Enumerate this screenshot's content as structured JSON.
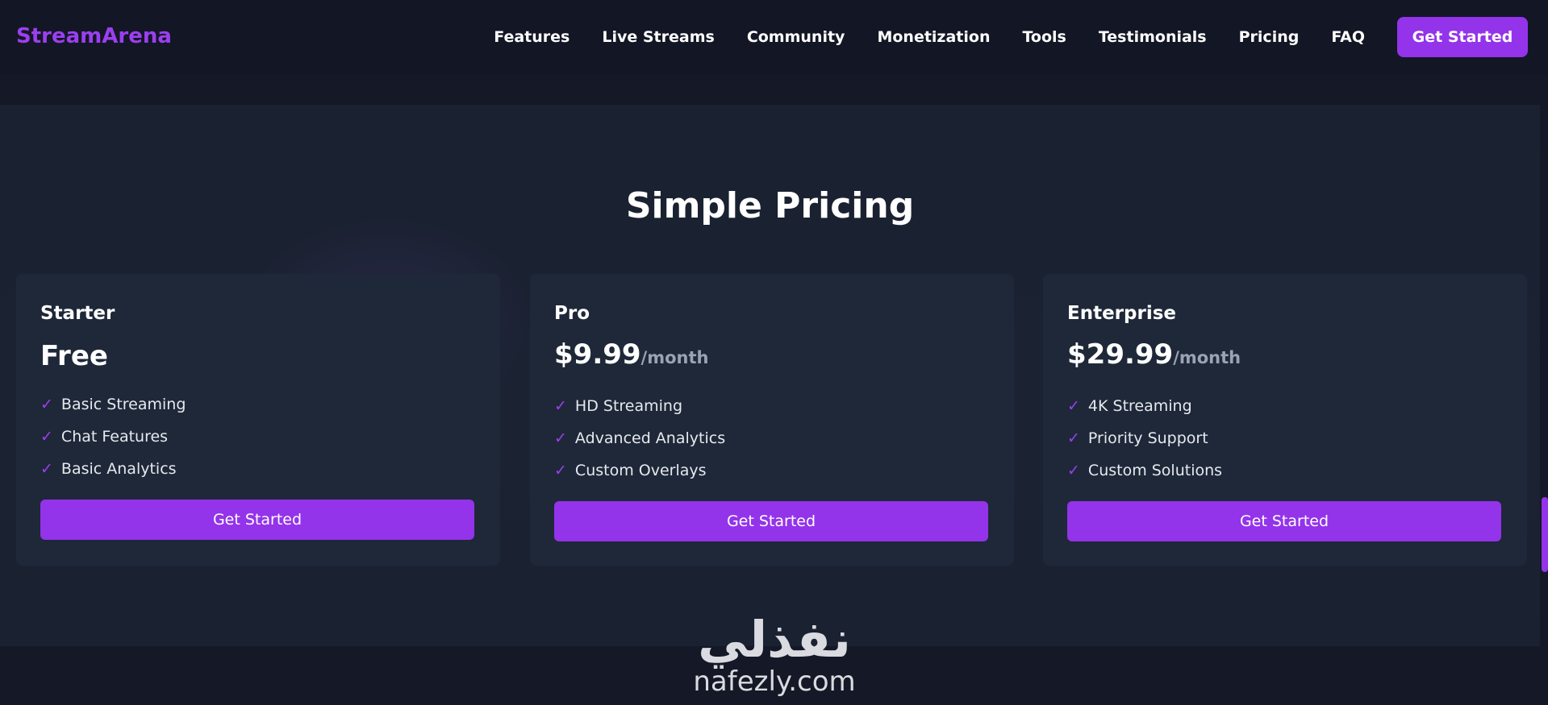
{
  "brand": "StreamArena",
  "nav": {
    "links": [
      "Features",
      "Live Streams",
      "Community",
      "Monetization",
      "Tools",
      "Testimonials",
      "Pricing",
      "FAQ"
    ],
    "cta_label": "Get Started"
  },
  "pricing": {
    "title": "Simple Pricing",
    "plans": [
      {
        "name": "Starter",
        "price": "Free",
        "period": "",
        "features": [
          "Basic Streaming",
          "Chat Features",
          "Basic Analytics"
        ],
        "button_label": "Get Started"
      },
      {
        "name": "Pro",
        "price": "$9.99",
        "period": "/month",
        "features": [
          "HD Streaming",
          "Advanced Analytics",
          "Custom Overlays"
        ],
        "button_label": "Get Started"
      },
      {
        "name": "Enterprise",
        "price": "$29.99",
        "period": "/month",
        "features": [
          "4K Streaming",
          "Priority Support",
          "Custom Solutions"
        ],
        "button_label": "Get Started"
      }
    ]
  },
  "check_glyph": "✓",
  "watermark": {
    "arabic": "نفذلي",
    "latin": "nafezly.com"
  },
  "colors": {
    "accent": "#9333ea",
    "brand": "#9b3ff0",
    "background": "#151826",
    "card": "#1e2838"
  }
}
